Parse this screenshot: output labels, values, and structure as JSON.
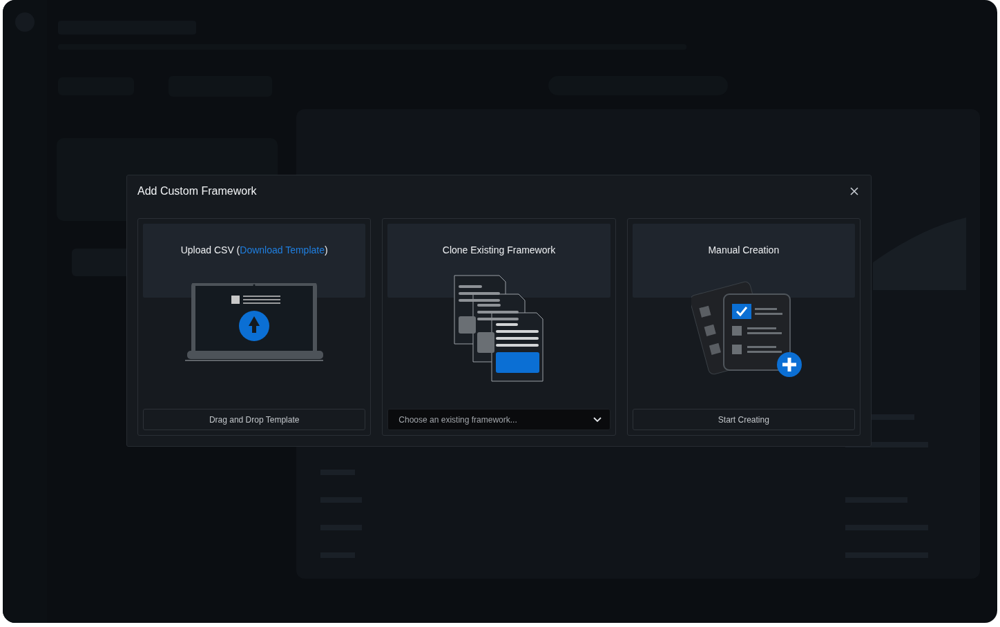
{
  "dialog": {
    "title": "Add Custom Framework",
    "cards": [
      {
        "kind": "upload",
        "title": "Upload CSV (",
        "link": "Download Template",
        "title_end": ")",
        "action": "Drag and Drop Template"
      },
      {
        "kind": "clone",
        "title": "Clone Existing Framework",
        "dropdown": {
          "placeholder": "Choose an existing framework..."
        }
      },
      {
        "kind": "manual",
        "title": "Manual Creation",
        "action": "Start Creating"
      }
    ]
  }
}
